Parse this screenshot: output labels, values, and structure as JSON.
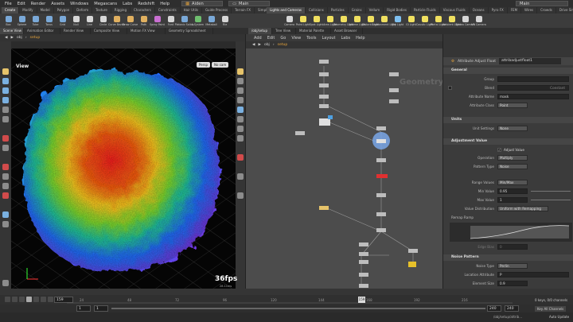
{
  "menubar": {
    "items": [
      "File",
      "Edit",
      "Render",
      "Assets",
      "Windows",
      "Megascans",
      "Labs",
      "Redshift",
      "Help"
    ],
    "context": "Aiden",
    "desktop": "Main",
    "right_label": "Main"
  },
  "shelf_tabs_left": [
    "Create",
    "Modify",
    "Model",
    "Polygon",
    "Deform",
    "Texture",
    "Rigging",
    "Characters",
    "Constraints",
    "Hair Utils",
    "Guide Process",
    "Terrain FX",
    "Simple FX",
    "Volume",
    "Personal"
  ],
  "shelf_tabs_right": [
    "Lights and Cameras",
    "Collisions",
    "Particles",
    "Grains",
    "Vellum",
    "Rigid Bodies",
    "Particle Fluids",
    "Viscous Fluids",
    "Oceans",
    "Pyro FX",
    "FEM",
    "Wires",
    "Crowds",
    "Drive Simulation"
  ],
  "shelf_tools_left": [
    {
      "label": "Box",
      "color": "#7aa9d8"
    },
    {
      "label": "Sphere",
      "color": "#7aa9d8"
    },
    {
      "label": "Tube",
      "color": "#7aa9d8"
    },
    {
      "label": "Torus",
      "color": "#7aa9d8"
    },
    {
      "label": "Grid",
      "color": "#7aa9d8"
    },
    {
      "label": "Null",
      "color": "#d6d6d6"
    },
    {
      "label": "Line",
      "color": "#d6d6d6"
    },
    {
      "label": "Circle",
      "color": "#d6d6d6"
    },
    {
      "label": "Curve Bezier",
      "color": "#e0b060"
    },
    {
      "label": "Draw Curve",
      "color": "#e0b060"
    },
    {
      "label": "Path",
      "color": "#e0b060"
    },
    {
      "label": "Spray Paint",
      "color": "#c96fd1"
    },
    {
      "label": "Font",
      "color": "#d6d6d6"
    },
    {
      "label": "Platonic Solids",
      "color": "#7aa9d8"
    },
    {
      "label": "L-System",
      "color": "#6fbf6f"
    },
    {
      "label": "Metaball",
      "color": "#7aa9d8"
    },
    {
      "label": "File",
      "color": "#d6d6d6"
    }
  ],
  "shelf_tools_right": [
    {
      "label": "Camera",
      "color": "#d6d6d6"
    },
    {
      "label": "Point Light",
      "color": "#f0e060"
    },
    {
      "label": "Spot Light",
      "color": "#f0e060"
    },
    {
      "label": "Area Light",
      "color": "#f0e060"
    },
    {
      "label": "Geometry Light",
      "color": "#f0e060"
    },
    {
      "label": "Volume Light",
      "color": "#f0e060"
    },
    {
      "label": "Distant Light",
      "color": "#f0e060"
    },
    {
      "label": "Environment Light",
      "color": "#f0e060"
    },
    {
      "label": "Sky Light",
      "color": "#7fc0f0"
    },
    {
      "label": "GI Light",
      "color": "#f0e060"
    },
    {
      "label": "Caustic Light",
      "color": "#f0e060"
    },
    {
      "label": "Portal Light",
      "color": "#f0e060"
    },
    {
      "label": "Ambient Light",
      "color": "#f0e060"
    },
    {
      "label": "Stereo Camera",
      "color": "#d6d6d6"
    },
    {
      "label": "VR Camera",
      "color": "#d6d6d6"
    }
  ],
  "pane_tabs_left": [
    "Scene View",
    "Animation Editor",
    "Render View",
    "Composite View",
    "Motion FX View",
    "Geometry Spreadsheet"
  ],
  "pane_tabs_right": [
    "/obj/setup",
    "Tree View",
    "Material Palette",
    "Asset Browser"
  ],
  "viewer": {
    "path": [
      "obj",
      "setup"
    ],
    "label": "View",
    "persp": "Persp",
    "cam": "No cam",
    "fps": "36fps",
    "fps_sub": "28.11ms"
  },
  "network": {
    "menu": [
      "Add",
      "Edit",
      "Go",
      "View",
      "Tools",
      "Layout",
      "Labs",
      "Help"
    ],
    "path": [
      "obj",
      "setup"
    ],
    "context_label": "Geometry"
  },
  "params": {
    "node_type": "Attribute Adjust Float",
    "node_name": "attribadjustfloat1",
    "sections": {
      "general": "General",
      "units": "Units",
      "adjust": "Adjustment Value",
      "noise": "Noise Pattern"
    },
    "rows": {
      "group_label": "Group",
      "group_value": "",
      "blend_label": "Blend",
      "blend_value": "Constant",
      "attr_name_label": "Attribute Name",
      "attr_name_value": "mask",
      "attr_class_label": "Attribute Class",
      "attr_class_value": "Point",
      "unit_label": "Unit Settings",
      "unit_value": "None",
      "adjust_value_label": "Adjust Value",
      "operation_label": "Operation",
      "operation_value": "Multiply",
      "pattern_label": "Pattern Type",
      "pattern_value": "Noise",
      "range_label": "Range Values",
      "range_value": "Min/Max",
      "min_label": "Min Value",
      "min_value": "0.95",
      "max_label": "Max Value",
      "max_value": "1",
      "dist_label": "Value Distribution",
      "dist_value": "Uniform with Remapping",
      "remap_label": "Remap Ramp",
      "edge_label": "Edge Bias",
      "edge_value": "0",
      "noise_type_label": "Noise Type",
      "noise_type_value": "Perlin",
      "loc_label": "Location Attribute",
      "loc_value": "P",
      "size_label": "Element Size",
      "size_value": "0.9"
    }
  },
  "timeline": {
    "frame": "159",
    "start": "1",
    "start2": "1",
    "end": "240",
    "end2": "240",
    "ticks": [
      "24",
      "48",
      "72",
      "96",
      "120",
      "144",
      "168",
      "192",
      "216"
    ],
    "keys_label": "0 keys, 0/0 channels",
    "key_all": "Key All Channels",
    "auto_update": "Auto Update",
    "status_path": "/obj/setup/attrib..."
  },
  "colors": {
    "accent": "#e6a33a",
    "network_bg": "#4c4c4c",
    "viewport_bg": "#050505"
  }
}
